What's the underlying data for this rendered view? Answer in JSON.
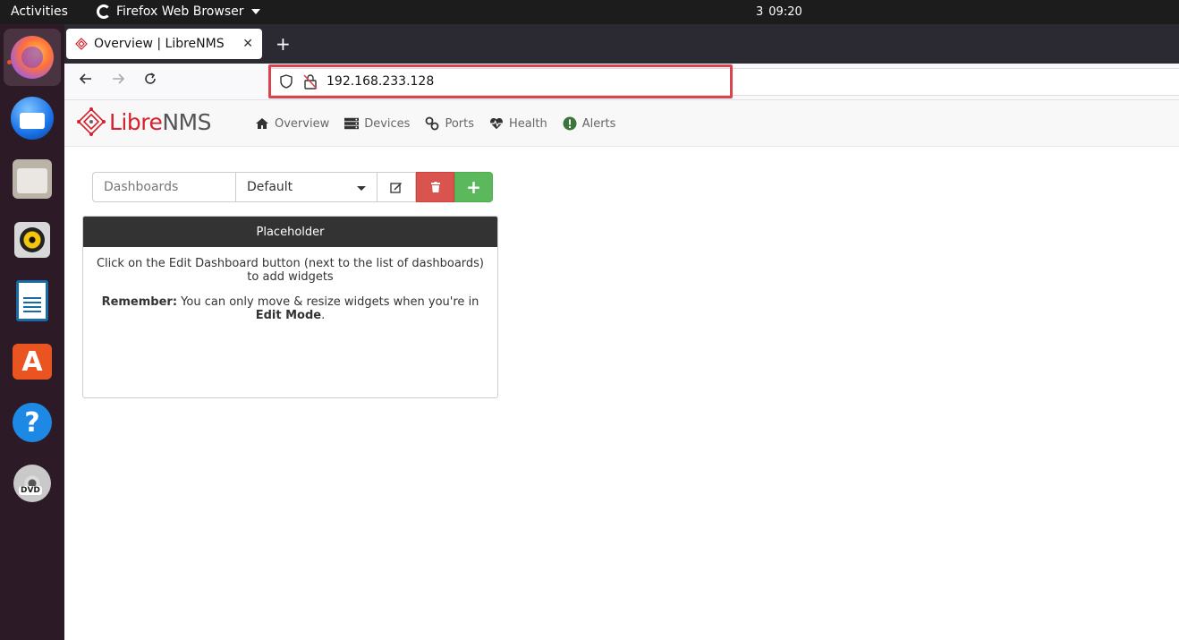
{
  "topbar": {
    "activities": "Activities",
    "app_name": "Firefox Web Browser",
    "clock_prefix": "3",
    "clock_time": "09:20"
  },
  "dock": {
    "items": [
      {
        "name": "Firefox",
        "icon": "firefox-icon",
        "active": true
      },
      {
        "name": "Thunderbird",
        "icon": "thunderbird-icon"
      },
      {
        "name": "Files",
        "icon": "files-icon"
      },
      {
        "name": "Rhythmbox",
        "icon": "rhythmbox-icon"
      },
      {
        "name": "LibreOffice Writer",
        "icon": "writer-icon"
      },
      {
        "name": "Ubuntu Software",
        "icon": "software-icon"
      },
      {
        "name": "Help",
        "icon": "help-icon"
      },
      {
        "name": "DVD",
        "icon": "dvd-icon"
      }
    ],
    "store_glyph": "A",
    "help_glyph": "?"
  },
  "browser": {
    "tab_title": "Overview | LibreNMS",
    "tab_close": "✕",
    "new_tab": "+",
    "url": "192.168.233.128",
    "highlight_color": "#d9444f"
  },
  "librenms": {
    "logo_libre": "Libre",
    "logo_nms": "NMS",
    "menu": [
      {
        "label": "Overview",
        "icon": "home-icon"
      },
      {
        "label": "Devices",
        "icon": "server-icon"
      },
      {
        "label": "Ports",
        "icon": "link-icon"
      },
      {
        "label": "Health",
        "icon": "heartbeat-icon"
      },
      {
        "label": "Alerts",
        "icon": "alert-icon"
      }
    ],
    "dashboard": {
      "label": "Dashboards",
      "selected": "Default",
      "add_glyph": "+"
    },
    "widget": {
      "title": "Placeholder",
      "line1": "Click on the Edit Dashboard button (next to the list of dashboards) to add widgets",
      "remember_bold": "Remember:",
      "remember_text": " You can only move & resize widgets when you're in ",
      "edit_mode_bold": "Edit Mode",
      "period": "."
    },
    "colors": {
      "brand_red": "#d5212e",
      "danger": "#d9534f",
      "success": "#5cb85c",
      "alerts_green": "#3c763d"
    }
  }
}
